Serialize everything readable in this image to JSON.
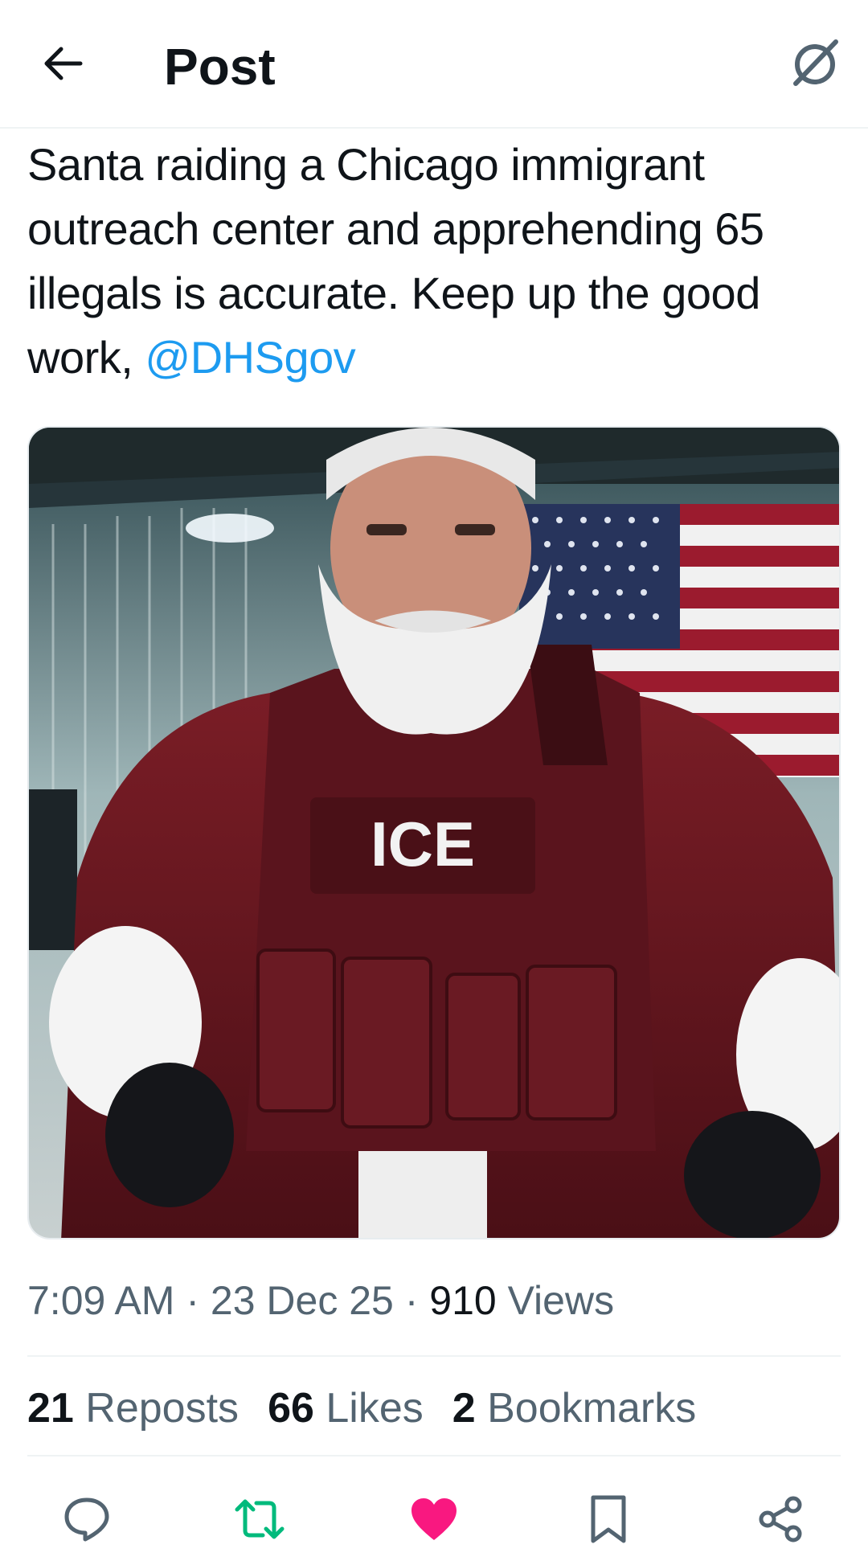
{
  "header": {
    "title": "Post",
    "back_icon": "arrow-left-icon",
    "grok_icon": "grok-icon"
  },
  "post": {
    "text": "Santa raiding a Chicago immigrant outreach center and apprehending 65 illegals is accurate. Keep up the good work, ",
    "mention": "@DHSgov",
    "media": {
      "description_icon": "santa-ice-image",
      "vest_label": "ICE"
    },
    "time": "7:09 AM",
    "sep1": " · ",
    "date": "23 Dec 25",
    "sep2": " · ",
    "views_count": "910",
    "views_label": " Views"
  },
  "stats": {
    "reposts_count": "21",
    "reposts_label": " Reposts",
    "likes_count": "66",
    "likes_label": " Likes",
    "bookmarks_count": "2",
    "bookmarks_label": " Bookmarks"
  },
  "actions": {
    "reply_icon": "reply-icon",
    "repost_icon": "repost-icon",
    "like_icon": "heart-icon",
    "bookmark_icon": "bookmark-icon",
    "share_icon": "share-icon"
  },
  "colors": {
    "accent": "#1d9bf0",
    "repost_active": "#00ba7c",
    "like_active": "#f91880",
    "muted": "#536471",
    "text": "#0f1419"
  }
}
